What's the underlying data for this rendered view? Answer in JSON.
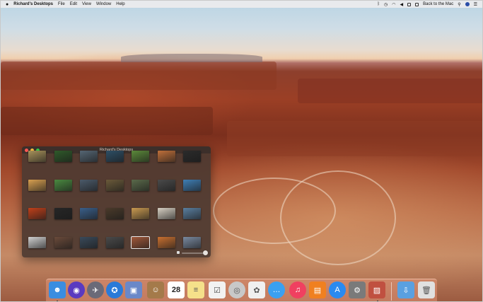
{
  "menubar": {
    "app_name": "Richard's Desktops",
    "menus": [
      "File",
      "Edit",
      "View",
      "Window",
      "Help"
    ],
    "status_text": "Back to the Mac"
  },
  "window": {
    "title": "Richard's Desktops",
    "thumbnail_count": 28
  },
  "dock": {
    "calendar_day": "28",
    "icons": [
      "finder-icon",
      "siri-icon",
      "launchpad-icon",
      "safari-icon",
      "preview-icon",
      "contacts-icon",
      "calendar-icon",
      "notes-icon",
      "reminders-icon",
      "image-capture-icon",
      "photos-icon",
      "messages-icon",
      "music-icon",
      "books-icon",
      "app-store-icon",
      "system-preferences-icon",
      "desktop-app-icon",
      "downloads-icon",
      "trash-icon"
    ]
  },
  "colors": {
    "menubar": "#ececee",
    "window_bg": "#4e3a32",
    "dock_bg": "#e49678"
  }
}
